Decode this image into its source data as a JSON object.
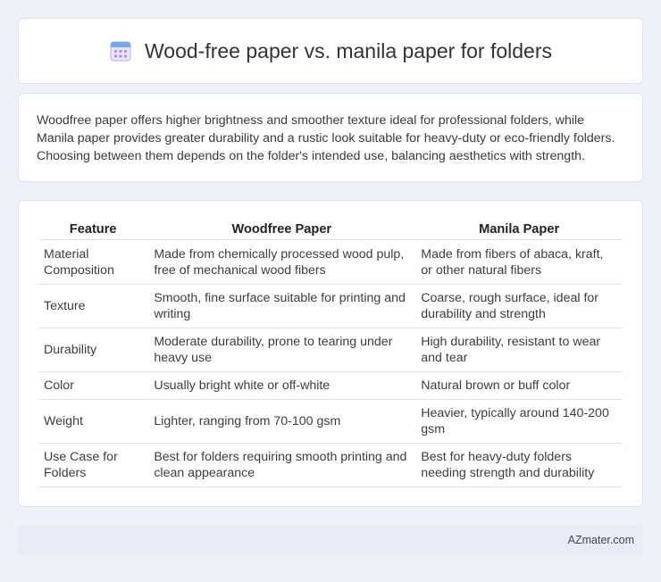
{
  "header": {
    "title": "Wood-free paper vs. manila paper for folders",
    "icon": "calendar-icon"
  },
  "summary": {
    "text": "Woodfree paper offers higher brightness and smoother texture ideal for professional folders, while Manila paper provides greater durability and a rustic look suitable for heavy-duty or eco-friendly folders. Choosing between them depends on the folder's intended use, balancing aesthetics with strength."
  },
  "table": {
    "headers": [
      "Feature",
      "Woodfree Paper",
      "Manila Paper"
    ],
    "rows": [
      [
        "Material Composition",
        "Made from chemically processed wood pulp, free of mechanical wood fibers",
        "Made from fibers of abaca, kraft, or other natural fibers"
      ],
      [
        "Texture",
        "Smooth, fine surface suitable for printing and writing",
        "Coarse, rough surface, ideal for durability and strength"
      ],
      [
        "Durability",
        "Moderate durability, prone to tearing under heavy use",
        "High durability, resistant to wear and tear"
      ],
      [
        "Color",
        "Usually bright white or off-white",
        "Natural brown or buff color"
      ],
      [
        "Weight",
        "Lighter, ranging from 70-100 gsm",
        "Heavier, typically around 140-200 gsm"
      ],
      [
        "Use Case for Folders",
        "Best for folders requiring smooth printing and clean appearance",
        "Best for heavy-duty folders needing strength and durability"
      ]
    ]
  },
  "footer": {
    "text": "AZmater.com"
  }
}
